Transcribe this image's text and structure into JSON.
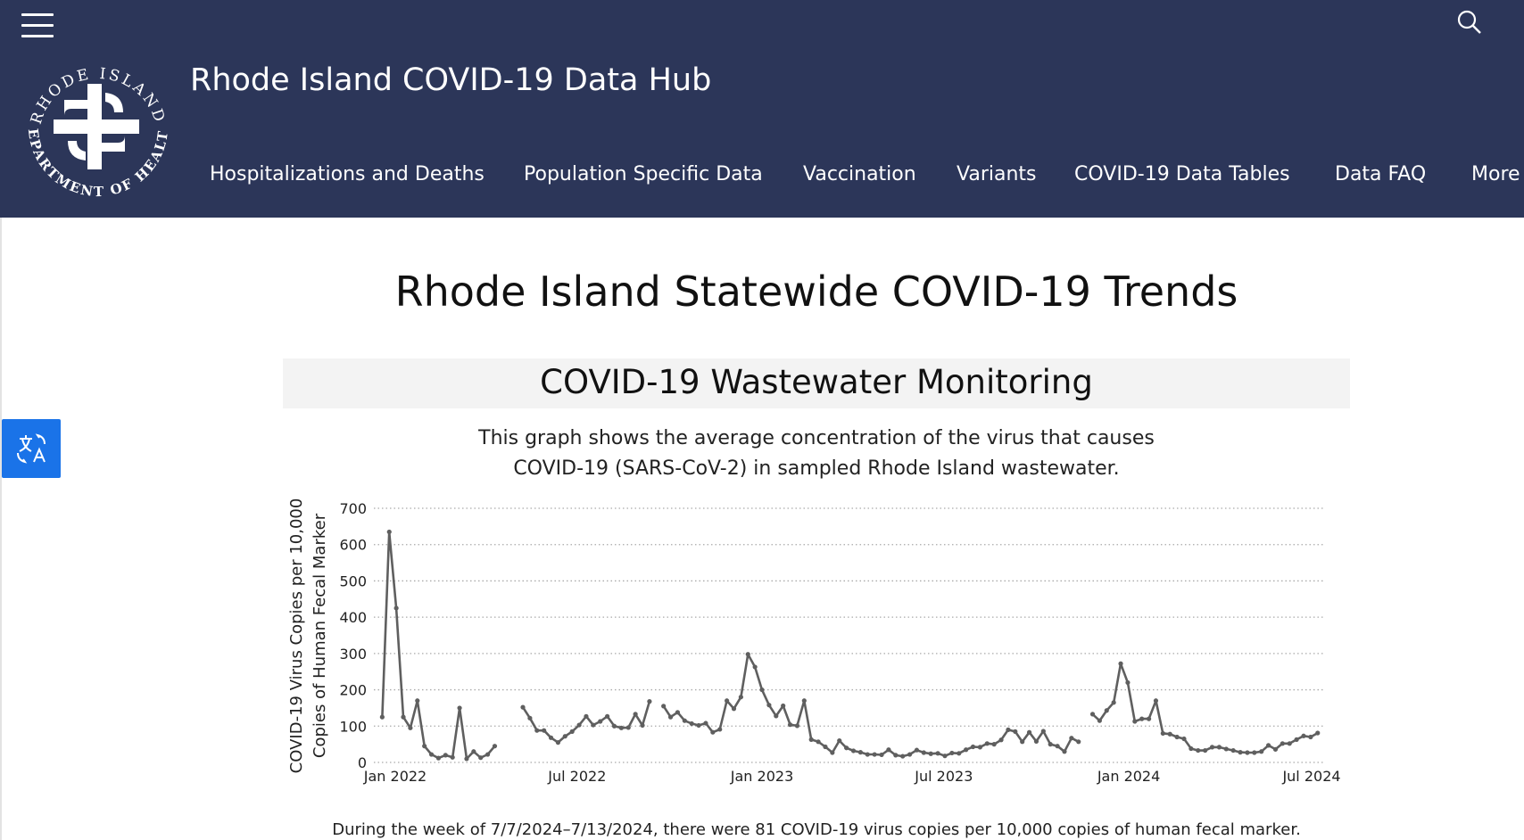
{
  "header": {
    "site_title": "Rhode Island COVID-19 Data Hub",
    "logo_text_top": "RHODE ISLAND",
    "logo_text_bottom": "DEPARTMENT OF HEALTH",
    "background_color": "#2c3659",
    "icons": {
      "menu": "hamburger-icon",
      "search": "search-icon"
    }
  },
  "nav": {
    "items": [
      {
        "label": "Hospitalizations and Deaths"
      },
      {
        "label": "Population Specific Data"
      },
      {
        "label": "Vaccination"
      },
      {
        "label": "Variants"
      },
      {
        "label": "COVID-19 Data Tables"
      },
      {
        "label": "Data FAQ"
      },
      {
        "label": "More"
      }
    ]
  },
  "translate_button": {
    "icon": "translate-icon",
    "color": "#1a73e8"
  },
  "main": {
    "page_title": "Rhode Island Statewide COVID-19 Trends",
    "section_title": "COVID-19 Wastewater Monitoring",
    "description_line1": "This graph shows the average concentration of the virus that causes",
    "description_line2": "COVID-19 (SARS-CoV-2) in sampled Rhode Island wastewater.",
    "footer_text": "During the week of 7/7/2024–7/13/2024, there were 81 COVID-19 virus copies per 10,000 copies of human fecal marker."
  },
  "chart_data": {
    "type": "line",
    "ylabel_line1": "COVID-19 Virus Copies per 10,000",
    "ylabel_line2": "Copies of Human Fecal Marker",
    "xlabel": "",
    "ylim": [
      0,
      700
    ],
    "yticks": [
      "0",
      "100",
      "200",
      "300",
      "400",
      "500",
      "600",
      "700"
    ],
    "xticks": [
      {
        "date": "2022-01-01",
        "label": "Jan 2022"
      },
      {
        "date": "2022-07-01",
        "label": "Jul 2022"
      },
      {
        "date": "2023-01-01",
        "label": "Jan 2023"
      },
      {
        "date": "2023-07-01",
        "label": "Jul 2023"
      },
      {
        "date": "2024-01-01",
        "label": "Jan 2024"
      },
      {
        "date": "2024-07-01",
        "label": "Jul 2024"
      }
    ],
    "grid": "horizontal dotted",
    "line_color": "#5f5f5f",
    "segments": [
      [
        [
          "2021-12-19",
          125
        ],
        [
          "2021-12-26",
          635
        ],
        [
          "2022-01-02",
          425
        ],
        [
          "2022-01-09",
          125
        ],
        [
          "2022-01-16",
          95
        ],
        [
          "2022-01-23",
          170
        ],
        [
          "2022-01-30",
          45
        ],
        [
          "2022-02-06",
          22
        ],
        [
          "2022-02-13",
          12
        ],
        [
          "2022-02-20",
          20
        ],
        [
          "2022-02-27",
          14
        ],
        [
          "2022-03-06",
          150
        ],
        [
          "2022-03-13",
          10
        ],
        [
          "2022-03-20",
          30
        ],
        [
          "2022-03-27",
          13
        ],
        [
          "2022-04-03",
          22
        ],
        [
          "2022-04-10",
          45
        ]
      ],
      [
        [
          "2022-05-08",
          152
        ],
        [
          "2022-05-15",
          122
        ],
        [
          "2022-05-22",
          88
        ],
        [
          "2022-05-29",
          88
        ],
        [
          "2022-06-05",
          68
        ],
        [
          "2022-06-12",
          55
        ],
        [
          "2022-06-19",
          72
        ],
        [
          "2022-06-26",
          85
        ],
        [
          "2022-07-03",
          103
        ],
        [
          "2022-07-10",
          127
        ],
        [
          "2022-07-17",
          103
        ],
        [
          "2022-07-24",
          113
        ],
        [
          "2022-07-31",
          127
        ],
        [
          "2022-08-07",
          100
        ],
        [
          "2022-08-14",
          95
        ],
        [
          "2022-08-21",
          96
        ],
        [
          "2022-08-28",
          133
        ],
        [
          "2022-09-04",
          102
        ],
        [
          "2022-09-11",
          168
        ]
      ],
      [
        [
          "2022-09-25",
          155
        ],
        [
          "2022-10-02",
          125
        ],
        [
          "2022-10-09",
          138
        ],
        [
          "2022-10-16",
          115
        ],
        [
          "2022-10-23",
          107
        ],
        [
          "2022-10-30",
          102
        ],
        [
          "2022-11-06",
          108
        ],
        [
          "2022-11-13",
          83
        ],
        [
          "2022-11-20",
          91
        ],
        [
          "2022-11-27",
          170
        ],
        [
          "2022-12-04",
          148
        ],
        [
          "2022-12-11",
          180
        ],
        [
          "2022-12-18",
          298
        ],
        [
          "2022-12-25",
          263
        ],
        [
          "2023-01-01",
          200
        ],
        [
          "2023-01-08",
          158
        ],
        [
          "2023-01-15",
          128
        ],
        [
          "2023-01-22",
          156
        ],
        [
          "2023-01-29",
          104
        ],
        [
          "2023-02-05",
          101
        ],
        [
          "2023-02-12",
          170
        ],
        [
          "2023-02-19",
          63
        ],
        [
          "2023-02-26",
          57
        ],
        [
          "2023-03-05",
          43
        ],
        [
          "2023-03-12",
          27
        ],
        [
          "2023-03-19",
          60
        ],
        [
          "2023-03-26",
          40
        ],
        [
          "2023-04-02",
          32
        ],
        [
          "2023-04-09",
          28
        ],
        [
          "2023-04-16",
          22
        ],
        [
          "2023-04-23",
          22
        ],
        [
          "2023-04-30",
          21
        ],
        [
          "2023-05-07",
          35
        ],
        [
          "2023-05-14",
          20
        ],
        [
          "2023-05-21",
          17
        ],
        [
          "2023-05-28",
          22
        ],
        [
          "2023-06-04",
          34
        ],
        [
          "2023-06-11",
          27
        ],
        [
          "2023-06-18",
          24
        ],
        [
          "2023-06-25",
          25
        ],
        [
          "2023-07-02",
          18
        ],
        [
          "2023-07-09",
          26
        ],
        [
          "2023-07-16",
          25
        ],
        [
          "2023-07-23",
          35
        ],
        [
          "2023-07-30",
          43
        ],
        [
          "2023-08-06",
          42
        ],
        [
          "2023-08-13",
          52
        ],
        [
          "2023-08-20",
          50
        ],
        [
          "2023-08-27",
          62
        ],
        [
          "2023-09-03",
          90
        ],
        [
          "2023-09-10",
          85
        ],
        [
          "2023-09-17",
          57
        ],
        [
          "2023-09-24",
          83
        ],
        [
          "2023-10-01",
          58
        ],
        [
          "2023-10-08",
          86
        ],
        [
          "2023-10-15",
          50
        ],
        [
          "2023-10-22",
          45
        ],
        [
          "2023-10-29",
          30
        ],
        [
          "2023-11-05",
          67
        ],
        [
          "2023-11-12",
          57
        ]
      ],
      [
        [
          "2023-11-26",
          133
        ],
        [
          "2023-12-03",
          115
        ],
        [
          "2023-12-10",
          143
        ],
        [
          "2023-12-17",
          165
        ],
        [
          "2023-12-24",
          272
        ],
        [
          "2023-12-31",
          220
        ],
        [
          "2024-01-07",
          113
        ],
        [
          "2024-01-14",
          120
        ],
        [
          "2024-01-21",
          120
        ],
        [
          "2024-01-28",
          170
        ],
        [
          "2024-02-04",
          80
        ],
        [
          "2024-02-11",
          78
        ],
        [
          "2024-02-18",
          70
        ],
        [
          "2024-02-25",
          65
        ],
        [
          "2024-03-03",
          38
        ],
        [
          "2024-03-10",
          33
        ],
        [
          "2024-03-17",
          33
        ],
        [
          "2024-03-24",
          42
        ],
        [
          "2024-03-31",
          42
        ],
        [
          "2024-04-07",
          37
        ],
        [
          "2024-04-14",
          33
        ],
        [
          "2024-04-21",
          28
        ],
        [
          "2024-04-28",
          27
        ],
        [
          "2024-05-05",
          27
        ],
        [
          "2024-05-12",
          30
        ],
        [
          "2024-05-19",
          47
        ],
        [
          "2024-05-26",
          36
        ],
        [
          "2024-06-02",
          52
        ],
        [
          "2024-06-09",
          52
        ],
        [
          "2024-06-16",
          63
        ],
        [
          "2024-06-23",
          73
        ],
        [
          "2024-06-30",
          70
        ],
        [
          "2024-07-07",
          81
        ]
      ]
    ]
  }
}
